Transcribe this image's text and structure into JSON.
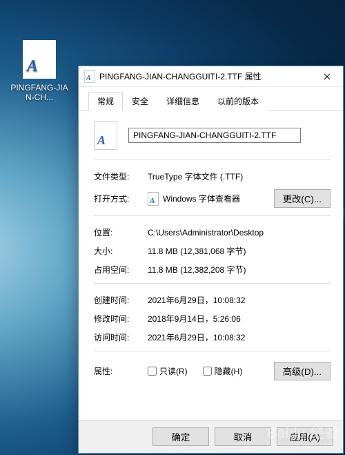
{
  "desktop": {
    "icon_label": "PINGFANG-JIAN-CH..."
  },
  "edge_text": "IN",
  "watermark": {
    "brand": "Baidu 经验",
    "url": "jingyan.baidu.com"
  },
  "dialog": {
    "title": "PINGFANG-JIAN-CHANGGUITI-2.TTF 属性",
    "tabs": {
      "general": "常规",
      "security": "安全",
      "details": "详细信息",
      "previous": "以前的版本"
    },
    "filename": "PINGFANG-JIAN-CHANGGUITI-2.TTF",
    "labels": {
      "filetype": "文件类型:",
      "openwith": "打开方式:",
      "location": "位置:",
      "size": "大小:",
      "sizeondisk": "占用空间:",
      "created": "创建时间:",
      "modified": "修改时间:",
      "accessed": "访问时间:",
      "attributes": "属性:"
    },
    "values": {
      "filetype": "TrueType 字体文件 (.TTF)",
      "openwith": "Windows 字体查看器",
      "location": "C:\\Users\\Administrator\\Desktop",
      "size": "11.8 MB (12,381,068 字节)",
      "sizeondisk": "11.8 MB (12,382,208 字节)",
      "created": "2021年6月29日，10:08:32",
      "modified": "2018年9月14日，5:26:06",
      "accessed": "2021年6月29日，10:08:32"
    },
    "buttons": {
      "change": "更改(C)...",
      "advanced": "高级(D)...",
      "ok": "确定",
      "cancel": "取消",
      "apply": "应用(A)"
    },
    "checkboxes": {
      "readonly": "只读(R)",
      "hidden": "隐藏(H)"
    }
  }
}
